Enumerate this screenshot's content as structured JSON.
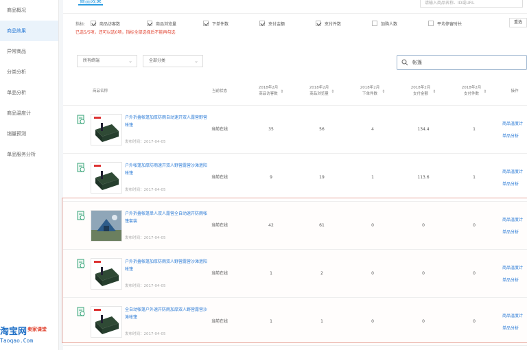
{
  "sidebar": {
    "items": [
      {
        "label": "商品概况",
        "active": false
      },
      {
        "label": "商品效果",
        "active": true
      },
      {
        "label": "异常商品",
        "active": false
      },
      {
        "label": "分类分析",
        "active": false
      },
      {
        "label": "单品分析",
        "active": false
      },
      {
        "label": "商品温度计",
        "active": false
      },
      {
        "label": "销量预测",
        "active": false
      },
      {
        "label": "单品服务分析",
        "active": false
      }
    ]
  },
  "header": {
    "tab": "商品效果",
    "top_search_placeholder": "请输入商品名称、ID或URL"
  },
  "metrics": {
    "label": "指标:",
    "options": [
      {
        "label": "商品访客数",
        "checked": true
      },
      {
        "label": "商品浏览量",
        "checked": true
      },
      {
        "label": "下单件数",
        "checked": true
      },
      {
        "label": "支付金额",
        "checked": true
      },
      {
        "label": "支付件数",
        "checked": true
      },
      {
        "label": "加购人数",
        "checked": false
      },
      {
        "label": "平均停留时长",
        "checked": false
      }
    ],
    "reset_label": "重选",
    "warning": "已选5/5项，还可以选0项，指标全部选择后不能再勾选"
  },
  "filters": {
    "select1": "所有终端",
    "select2": "全部分类",
    "search_value": "帐篷"
  },
  "table": {
    "headers": [
      "商品名称",
      "当前状态",
      "商品访客数",
      "商品浏览量",
      "下单件数",
      "支付金额",
      "支付件数",
      "操作"
    ],
    "header_prefix": "2018年2月",
    "rows": [
      {
        "name": "户外折叠帐篷加厚防雨自动速开双人露营野营帐篷",
        "date": "发布时间：2017-04-05",
        "status": "当前在线",
        "v1": "35",
        "v2": "56",
        "v3": "4",
        "v4": "134.4",
        "v5": "1",
        "op1": "商品温度计",
        "op2": "单品分析",
        "thumb": "tent"
      },
      {
        "name": "户外帐篷加厚防雨速开双人野营露营沙滩遮阳帐篷",
        "date": "发布时间：2017-04-05",
        "status": "当前在线",
        "v1": "9",
        "v2": "19",
        "v3": "1",
        "v4": "113.6",
        "v5": "1",
        "op1": "商品温度计",
        "op2": "单品分析",
        "thumb": "tent"
      },
      {
        "name": "户外折叠帐篷单人双人露营全自动速开防雨帐篷套装",
        "date": "发布时间：2017-04-05",
        "status": "当前在线",
        "v1": "42",
        "v2": "61",
        "v3": "0",
        "v4": "0",
        "v5": "0",
        "op1": "商品温度计",
        "op2": "单品分析",
        "thumb": "photo"
      },
      {
        "name": "户外折叠帐篷加厚防雨双人野营露营沙滩遮阳帐篷",
        "date": "发布时间：2017-04-05",
        "status": "当前在线",
        "v1": "1",
        "v2": "2",
        "v3": "0",
        "v4": "0",
        "v5": "0",
        "op1": "商品温度计",
        "op2": "单品分析",
        "thumb": "tent"
      },
      {
        "name": "全自动帐篷户外速开防雨加厚双人野营露营沙滩帐篷",
        "date": "发布时间：2017-04-05",
        "status": "当前在线",
        "v1": "1",
        "v2": "1",
        "v3": "0",
        "v4": "0",
        "v5": "0",
        "op1": "商品温度计",
        "op2": "单品分析",
        "thumb": "tent"
      }
    ]
  },
  "watermark": {
    "brand": "淘宝网",
    "sub": "卖家课堂",
    "url": "Taoqao.Com"
  }
}
